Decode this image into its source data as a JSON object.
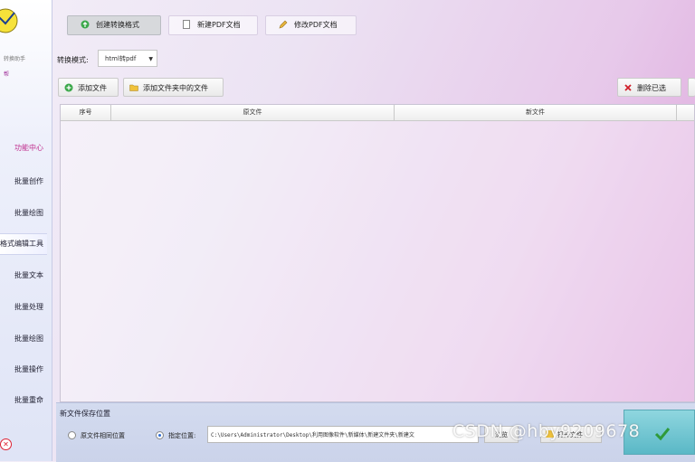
{
  "sidebar": {
    "logo_text": "转换助手",
    "logo_subtext": "帮",
    "items": [
      {
        "label": "功能中心"
      },
      {
        "label": "批量创作"
      },
      {
        "label": "批量绘图"
      },
      {
        "label": "格式编辑工具"
      },
      {
        "label": "批量文本"
      },
      {
        "label": "批量处理"
      },
      {
        "label": "批量绘图"
      },
      {
        "label": "批量操作"
      },
      {
        "label": "批量重命"
      }
    ],
    "active_index": 3,
    "section_index": 0
  },
  "tabs": [
    {
      "label": "创建转换格式",
      "icon": "convert-icon",
      "active": true
    },
    {
      "label": "新建PDF文档",
      "icon": "document-icon",
      "active": false
    },
    {
      "label": "修改PDF文档",
      "icon": "edit-icon",
      "active": false
    }
  ],
  "convert_mode": {
    "label": "转换模式:",
    "value": "html转pdf"
  },
  "toolbar": {
    "add_file": "添加文件",
    "add_folder": "添加文件夹中的文件",
    "delete_selected": "删除已选"
  },
  "table": {
    "columns": [
      "序号",
      "原文件",
      "新文件"
    ],
    "rows": []
  },
  "save": {
    "title": "新文件保存位置",
    "option_original": "原文件相同位置",
    "option_custom": "指定位置:",
    "selected": "custom",
    "path": "C:\\Users\\Administrator\\Desktop\\利用图像软件\\新媒体\\新建文件夹\\新建文",
    "browse_label": "浏览",
    "open_label": "打开文件"
  },
  "watermark": "CSDN @hby9209678",
  "colors": {
    "accent_pink": "#c0308f",
    "start_button": "#5ab8c6"
  }
}
